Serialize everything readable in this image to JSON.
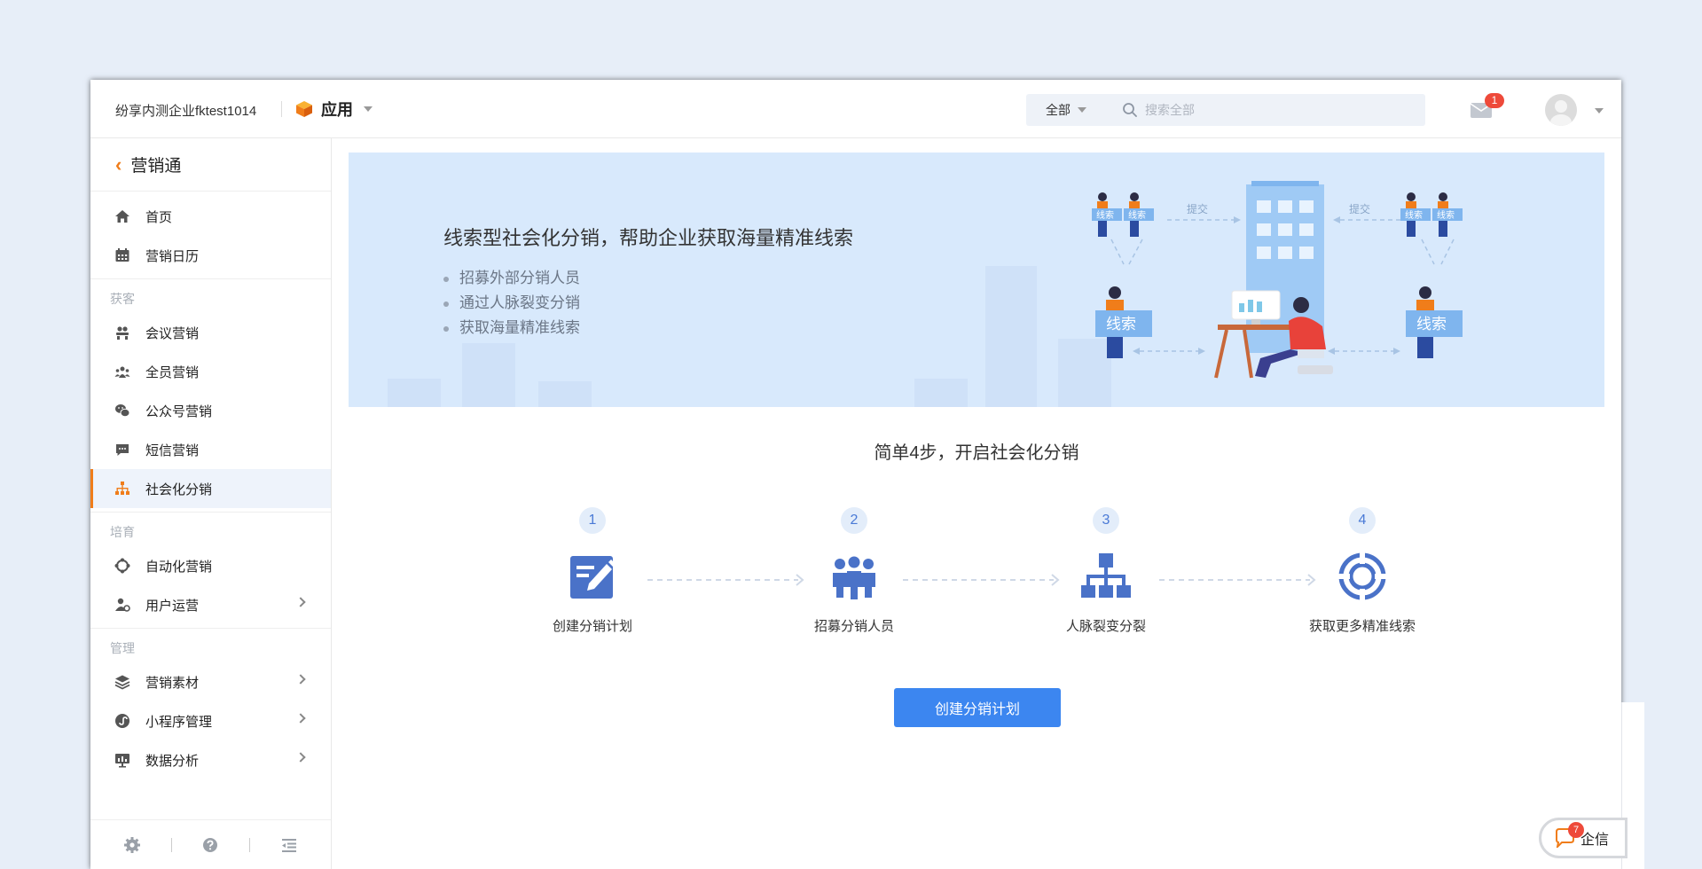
{
  "header": {
    "company": "纷享内测企业fktest1014",
    "app_label": "应用",
    "search_scope": "全部",
    "search_placeholder": "搜索全部",
    "mail_badge": "1"
  },
  "sidebar": {
    "title": "营销通",
    "items_top": [
      {
        "label": "首页",
        "icon": "home-icon"
      },
      {
        "label": "营销日历",
        "icon": "calendar-icon"
      }
    ],
    "section_acquire": "获客",
    "items_acquire": [
      {
        "label": "会议营销",
        "icon": "meeting-icon"
      },
      {
        "label": "全员营销",
        "icon": "team-icon"
      },
      {
        "label": "公众号营销",
        "icon": "wechat-icon"
      },
      {
        "label": "短信营销",
        "icon": "sms-icon"
      },
      {
        "label": "社会化分销",
        "icon": "distribution-icon",
        "active": true
      }
    ],
    "section_nurture": "培育",
    "items_nurture": [
      {
        "label": "自动化营销",
        "icon": "automation-icon"
      },
      {
        "label": "用户运营",
        "icon": "user-ops-icon",
        "expandable": true
      }
    ],
    "section_manage": "管理",
    "items_manage": [
      {
        "label": "营销素材",
        "icon": "layers-icon",
        "expandable": true
      },
      {
        "label": "小程序管理",
        "icon": "miniprogram-icon",
        "expandable": true
      },
      {
        "label": "数据分析",
        "icon": "analytics-icon",
        "expandable": true
      }
    ]
  },
  "banner": {
    "title": "线索型社会化分销，帮助企业获取海量精准线索",
    "bullets": [
      "招募外部分销人员",
      "通过人脉裂变分销",
      "获取海量精准线索"
    ],
    "art_lead": "线索",
    "art_submit": "提交"
  },
  "steps": {
    "title": "简单4步，开启社会化分销",
    "items": [
      {
        "num": "1",
        "label": "创建分销计划",
        "icon": "edit-plan-icon"
      },
      {
        "num": "2",
        "label": "招募分销人员",
        "icon": "recruit-people-icon"
      },
      {
        "num": "3",
        "label": "人脉裂变分裂",
        "icon": "org-tree-icon"
      },
      {
        "num": "4",
        "label": "获取更多精准线索",
        "icon": "target-icon"
      }
    ]
  },
  "primary_button": "创建分销计划",
  "qixin": {
    "label": "企信",
    "badge": "7"
  },
  "colors": {
    "accent": "#f07d1a",
    "primary": "#3c86f0",
    "icon_blue": "#4a72c8",
    "badge_red": "#ee4a3a"
  }
}
